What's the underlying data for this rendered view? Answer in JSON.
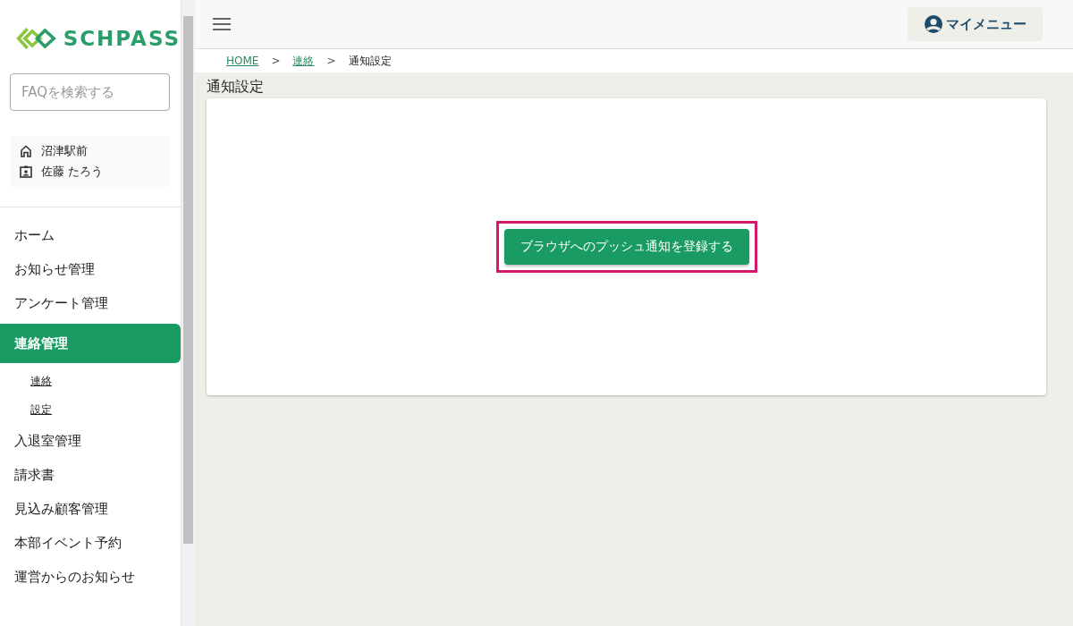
{
  "logo": {
    "text": "SCHPASS"
  },
  "search": {
    "placeholder": "FAQを検索する"
  },
  "user_info": [
    {
      "kind": "school",
      "text": "沼津駅前"
    },
    {
      "kind": "person",
      "text": "佐藤 たろう"
    }
  ],
  "sidebar": {
    "items": [
      {
        "label": "ホーム",
        "selected": false
      },
      {
        "label": "お知らせ管理",
        "selected": false
      },
      {
        "label": "アンケート管理",
        "selected": false
      },
      {
        "label": "連絡管理",
        "selected": true,
        "children": [
          {
            "label": "連絡"
          },
          {
            "label": "設定"
          }
        ]
      },
      {
        "label": "入退室管理",
        "selected": false
      },
      {
        "label": "請求書",
        "selected": false
      },
      {
        "label": "見込み顧客管理",
        "selected": false
      },
      {
        "label": "本部イベント予約",
        "selected": false
      },
      {
        "label": "運営からのお知らせ",
        "selected": false
      }
    ]
  },
  "header": {
    "my_menu": "マイメニュー"
  },
  "breadcrumb": [
    {
      "label": "HOME",
      "link": true
    },
    {
      "label": "連絡",
      "link": true
    },
    {
      "label": "通知設定",
      "link": false
    }
  ],
  "breadcrumb_separator": ">",
  "page_title": "通知設定",
  "card": {
    "button": "ブラウザへのプッシュ通知を登録する",
    "highlighted": true
  }
}
